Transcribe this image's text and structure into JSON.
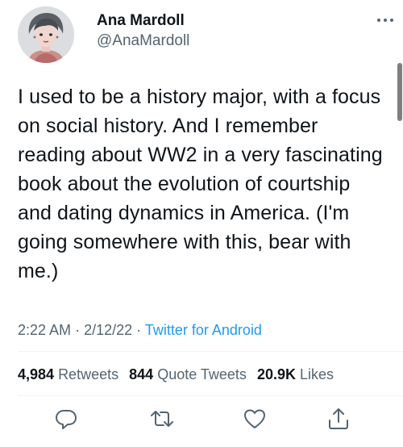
{
  "author": {
    "display_name": "Ana Mardoll",
    "handle": "@AnaMardoll",
    "avatar_icon": "profile-avatar"
  },
  "tweet": {
    "text": "I used to be a history major, with a focus on social history. And I remember reading about WW2 in a very fascinating book about the evolution of courtship and dating dynamics in America. (I'm going somewhere with this, bear with me.)",
    "time": "2:22 AM",
    "date": "2/12/22",
    "separator": "·",
    "source": "Twitter for Android"
  },
  "stats": {
    "retweets_count": "4,984",
    "retweets_label": "Retweets",
    "quotes_count": "844",
    "quotes_label": "Quote Tweets",
    "likes_count": "20.9K",
    "likes_label": "Likes"
  },
  "icons": {
    "more": "more-dots-icon",
    "reply": "reply-icon",
    "retweet": "retweet-icon",
    "like": "heart-icon",
    "share": "share-icon"
  },
  "colors": {
    "text": "#0f1419",
    "secondary": "#536471",
    "link": "#1d9bf0",
    "divider": "#eff3f4"
  }
}
